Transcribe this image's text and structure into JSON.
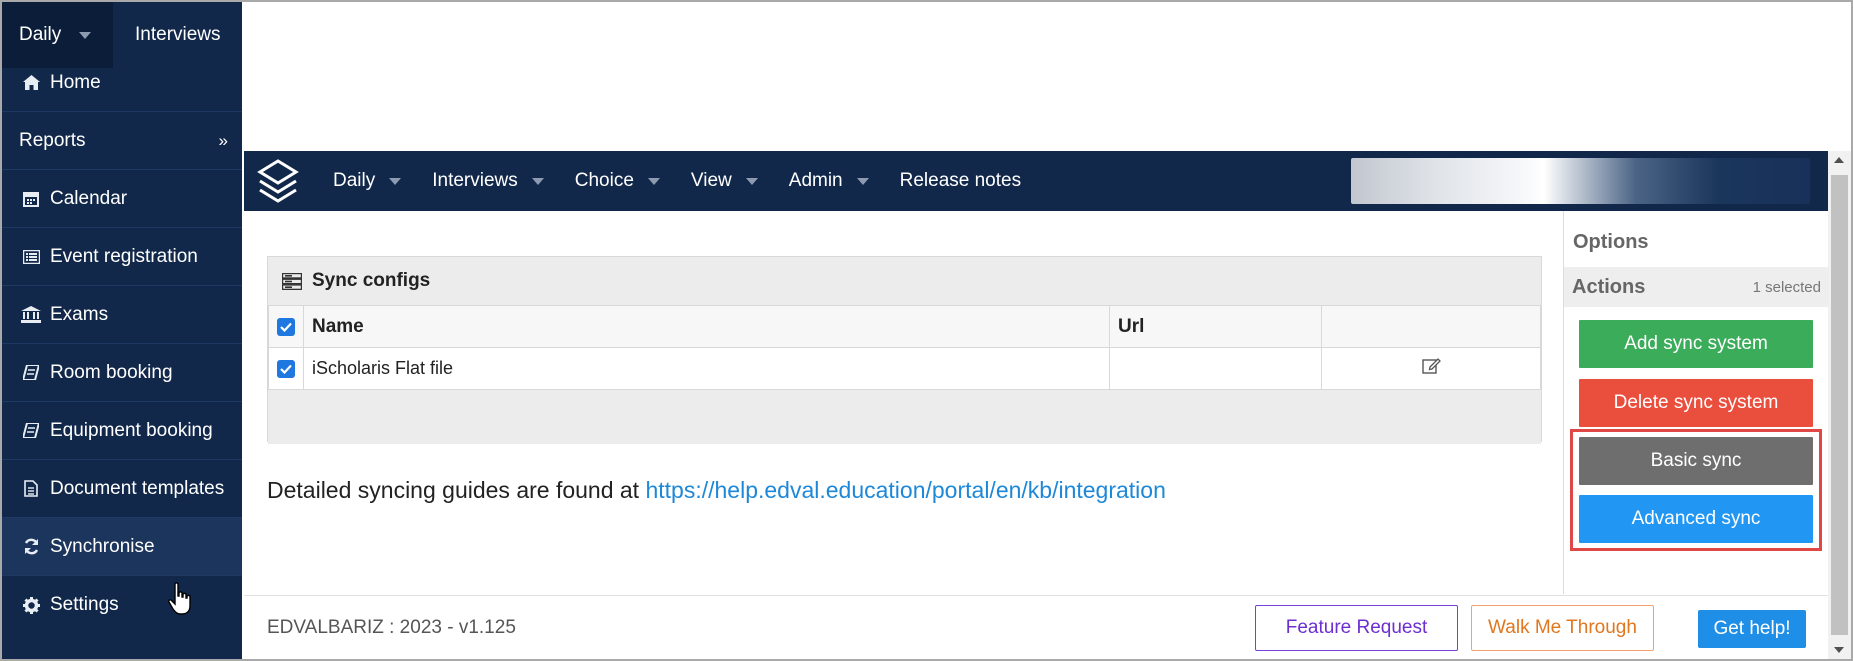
{
  "sidebar": {
    "top_tabs": [
      {
        "label": "Daily"
      },
      {
        "label": "Interviews"
      }
    ],
    "items": [
      {
        "label": "Home",
        "icon": "home-icon"
      },
      {
        "label": "Reports",
        "icon": "",
        "chevron": "»"
      },
      {
        "label": "Calendar",
        "icon": "calendar-icon"
      },
      {
        "label": "Event registration",
        "icon": "list-icon"
      },
      {
        "label": "Exams",
        "icon": "bank-icon"
      },
      {
        "label": "Room booking",
        "icon": "book-icon"
      },
      {
        "label": "Equipment booking",
        "icon": "book-icon"
      },
      {
        "label": "Document templates",
        "icon": "file-icon"
      },
      {
        "label": "Synchronise",
        "icon": "refresh-icon"
      },
      {
        "label": "Settings",
        "icon": "gear-icon"
      }
    ]
  },
  "topnav": {
    "items": [
      {
        "label": "Daily"
      },
      {
        "label": "Interviews"
      },
      {
        "label": "Choice"
      },
      {
        "label": "View"
      },
      {
        "label": "Admin"
      },
      {
        "label": "Release notes"
      }
    ]
  },
  "panel": {
    "title": "Sync configs",
    "columns": {
      "name": "Name",
      "url": "Url"
    },
    "rows": [
      {
        "name": "iScholaris Flat file",
        "url": "",
        "checked": true
      }
    ]
  },
  "guide": {
    "text": "Detailed syncing guides are found at ",
    "link": "https://help.edval.education/portal/en/kb/integration"
  },
  "options": {
    "title": "Options",
    "actions_label": "Actions",
    "selected_count": "1 selected",
    "buttons": {
      "add": "Add sync system",
      "delete": "Delete sync system",
      "basic": "Basic sync",
      "advanced": "Advanced sync"
    }
  },
  "footer": {
    "version": "EDVALBARIZ : 2023 - v1.125",
    "feature_request": "Feature Request",
    "walk_me": "Walk Me Through",
    "get_help": "Get help!"
  },
  "colors": {
    "nav_bg": "#12284a",
    "add": "#3aac5a",
    "delete": "#ea4e3d",
    "basic": "#6e6e6e",
    "advanced": "#2196f3",
    "link": "#1e88d8",
    "highlight": "#e04848"
  }
}
